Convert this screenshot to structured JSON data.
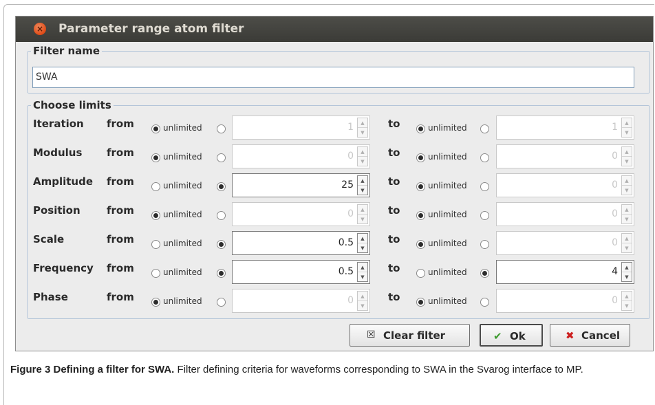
{
  "window": {
    "title": "Parameter range atom filter"
  },
  "filter_name": {
    "legend": "Filter name",
    "value": "SWA"
  },
  "limits": {
    "legend": "Choose limits",
    "from_label": "from",
    "to_label": "to",
    "unlimited_label": "unlimited",
    "rows": [
      {
        "param": "Iteration",
        "from": {
          "unlimited": true,
          "value": "1"
        },
        "to": {
          "unlimited": true,
          "value": "1"
        }
      },
      {
        "param": "Modulus",
        "from": {
          "unlimited": true,
          "value": "0"
        },
        "to": {
          "unlimited": true,
          "value": "0"
        }
      },
      {
        "param": "Amplitude",
        "from": {
          "unlimited": false,
          "value": "25"
        },
        "to": {
          "unlimited": true,
          "value": "0"
        }
      },
      {
        "param": "Position",
        "from": {
          "unlimited": true,
          "value": "0"
        },
        "to": {
          "unlimited": true,
          "value": "0"
        }
      },
      {
        "param": "Scale",
        "from": {
          "unlimited": false,
          "value": "0.5"
        },
        "to": {
          "unlimited": true,
          "value": "0"
        }
      },
      {
        "param": "Frequency",
        "from": {
          "unlimited": false,
          "value": "0.5"
        },
        "to": {
          "unlimited": false,
          "value": "4"
        }
      },
      {
        "param": "Phase",
        "from": {
          "unlimited": true,
          "value": "0"
        },
        "to": {
          "unlimited": true,
          "value": "0"
        }
      }
    ]
  },
  "buttons": {
    "clear": "Clear filter",
    "ok": "Ok",
    "cancel": "Cancel"
  },
  "caption": {
    "bold": "Figure 3 Defining a filter for SWA.",
    "text": " Filter defining criteria for waveforms corresponding to SWA in the Svarog interface to MP."
  }
}
